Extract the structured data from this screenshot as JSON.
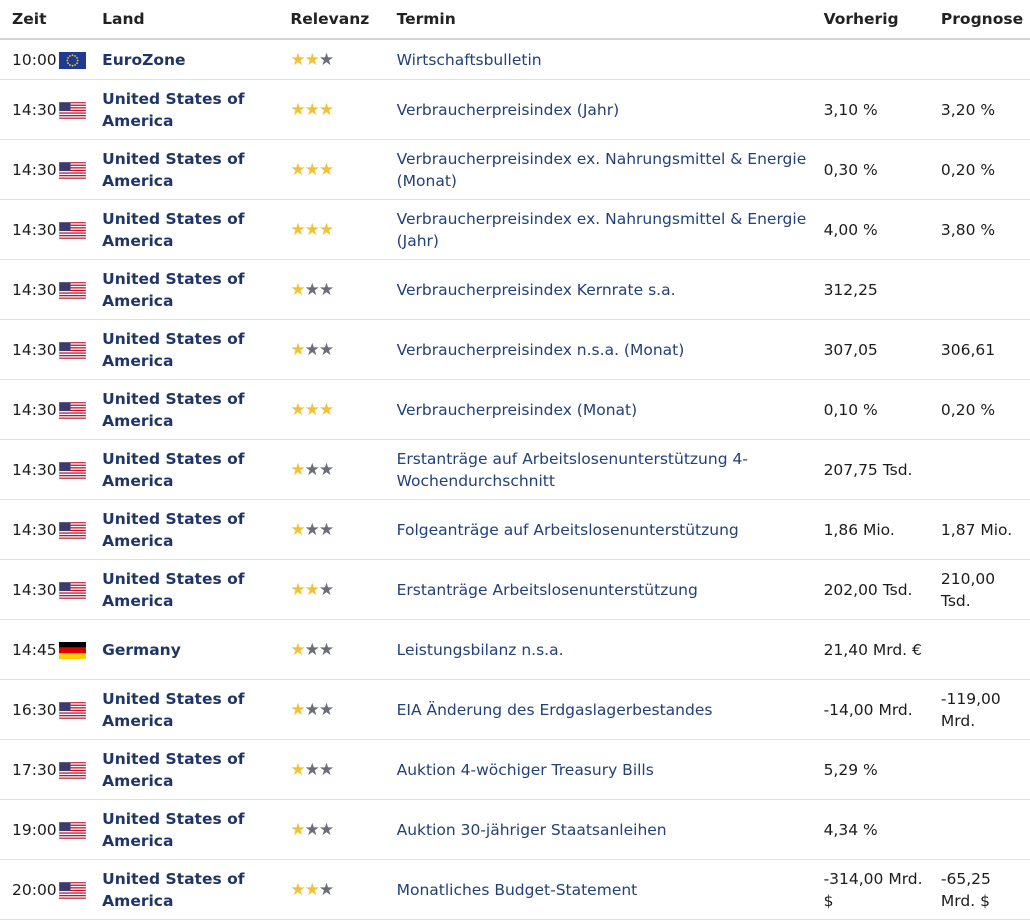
{
  "columns": {
    "time": "Zeit",
    "country": "Land",
    "relevance": "Relevanz",
    "event": "Termin",
    "previous": "Vorherig",
    "forecast": "Prognose"
  },
  "rows": [
    {
      "time": "10:00",
      "flag": "eu-flag-icon",
      "country": "EuroZone",
      "stars": 2,
      "event": "Wirtschaftsbulletin",
      "previous": "",
      "forecast": ""
    },
    {
      "time": "14:30",
      "flag": "us-flag-icon",
      "country": "United States of America",
      "stars": 3,
      "event": "Verbraucherpreisindex (Jahr)",
      "previous": "3,10 %",
      "forecast": "3,20 %"
    },
    {
      "time": "14:30",
      "flag": "us-flag-icon",
      "country": "United States of America",
      "stars": 3,
      "event": "Verbraucherpreisindex ex. Nahrungsmittel & Energie (Monat)",
      "previous": "0,30 %",
      "forecast": "0,20 %"
    },
    {
      "time": "14:30",
      "flag": "us-flag-icon",
      "country": "United States of America",
      "stars": 3,
      "event": "Verbraucherpreisindex ex. Nahrungsmittel & Energie (Jahr)",
      "previous": "4,00 %",
      "forecast": "3,80 %"
    },
    {
      "time": "14:30",
      "flag": "us-flag-icon",
      "country": "United States of America",
      "stars": 1,
      "event": "Verbraucherpreisindex Kernrate s.a.",
      "previous": "312,25",
      "forecast": ""
    },
    {
      "time": "14:30",
      "flag": "us-flag-icon",
      "country": "United States of America",
      "stars": 1,
      "event": "Verbraucherpreisindex n.s.a. (Monat)",
      "previous": "307,05",
      "forecast": "306,61"
    },
    {
      "time": "14:30",
      "flag": "us-flag-icon",
      "country": "United States of America",
      "stars": 3,
      "event": "Verbraucherpreisindex (Monat)",
      "previous": "0,10 %",
      "forecast": "0,20 %"
    },
    {
      "time": "14:30",
      "flag": "us-flag-icon",
      "country": "United States of America",
      "stars": 1,
      "event": "Erstanträge auf Arbeitslosenunterstützung 4-Wochendurchschnitt",
      "previous": "207,75 Tsd.",
      "forecast": ""
    },
    {
      "time": "14:30",
      "flag": "us-flag-icon",
      "country": "United States of America",
      "stars": 1,
      "event": "Folgeanträge auf Arbeitslosenunterstützung",
      "previous": "1,86 Mio.",
      "forecast": "1,87 Mio."
    },
    {
      "time": "14:30",
      "flag": "us-flag-icon",
      "country": "United States of America",
      "stars": 2,
      "event": "Erstanträge Arbeitslosenunterstützung",
      "previous": "202,00 Tsd.",
      "forecast": "210,00 Tsd."
    },
    {
      "time": "14:45",
      "flag": "de-flag-icon",
      "country": "Germany",
      "stars": 1,
      "event": "Leistungsbilanz n.s.a.",
      "previous": "21,40 Mrd. €",
      "forecast": ""
    },
    {
      "time": "16:30",
      "flag": "us-flag-icon",
      "country": "United States of America",
      "stars": 1,
      "event": "EIA Änderung des Erdgaslagerbestandes",
      "previous": "-14,00 Mrd.",
      "forecast": "-119,00 Mrd."
    },
    {
      "time": "17:30",
      "flag": "us-flag-icon",
      "country": "United States of America",
      "stars": 1,
      "event": "Auktion 4-wöchiger Treasury Bills",
      "previous": "5,29 %",
      "forecast": ""
    },
    {
      "time": "19:00",
      "flag": "us-flag-icon",
      "country": "United States of America",
      "stars": 1,
      "event": "Auktion 30-jähriger Staatsanleihen",
      "previous": "4,34 %",
      "forecast": ""
    },
    {
      "time": "20:00",
      "flag": "us-flag-icon",
      "country": "United States of America",
      "stars": 2,
      "event": "Monatliches Budget-Statement",
      "previous": "-314,00 Mrd. $",
      "forecast": "-65,25 Mrd. $"
    }
  ],
  "relevance_max": 3,
  "colors": {
    "star_on": "#f1c232",
    "star_off": "#6b6f75",
    "country": "#1f3566",
    "event_link": "#22407a"
  }
}
